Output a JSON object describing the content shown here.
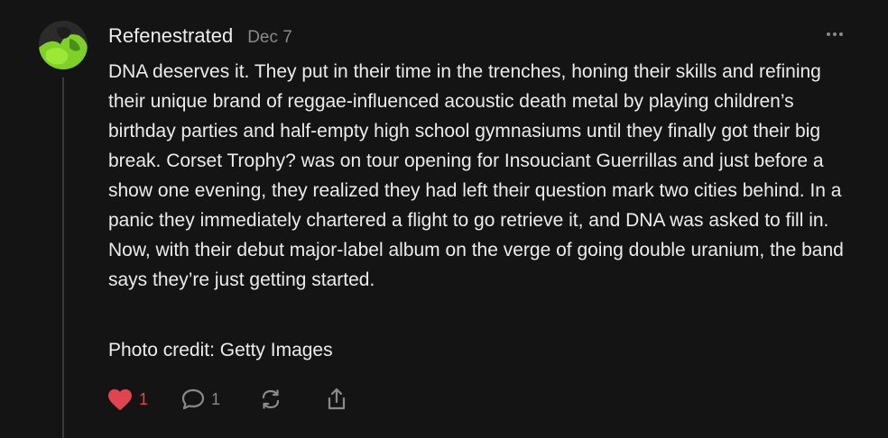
{
  "comment": {
    "author": "Refenestrated",
    "date": "Dec 7",
    "body": "DNA deserves it. They put in their time in the trenches, honing their skills and refining their unique brand of reggae-influenced acoustic death metal by playing children’s birthday parties and half-empty high school gymnasiums until they finally got their big break. Corset Trophy? was on tour opening for Insouciant Guerrillas and just before a show one evening, they realized they had left their question mark two cities behind. In a panic they immediately chartered a flight to go retrieve it, and DNA was asked to fill in. Now, with their debut major-label album on the verge of going double uranium, the band says they’re just getting started.",
    "credit": "Photo credit: Getty Images"
  },
  "actions": {
    "likes": "1",
    "comments": "1"
  },
  "icons": {
    "like": "heart-icon",
    "comment": "speech-bubble-icon",
    "restack": "restack-icon",
    "share": "share-icon",
    "more": "ellipsis-icon"
  },
  "colors": {
    "background": "#141414",
    "text": "#ececec",
    "muted": "#8a8a8a",
    "like": "#e0454f"
  }
}
